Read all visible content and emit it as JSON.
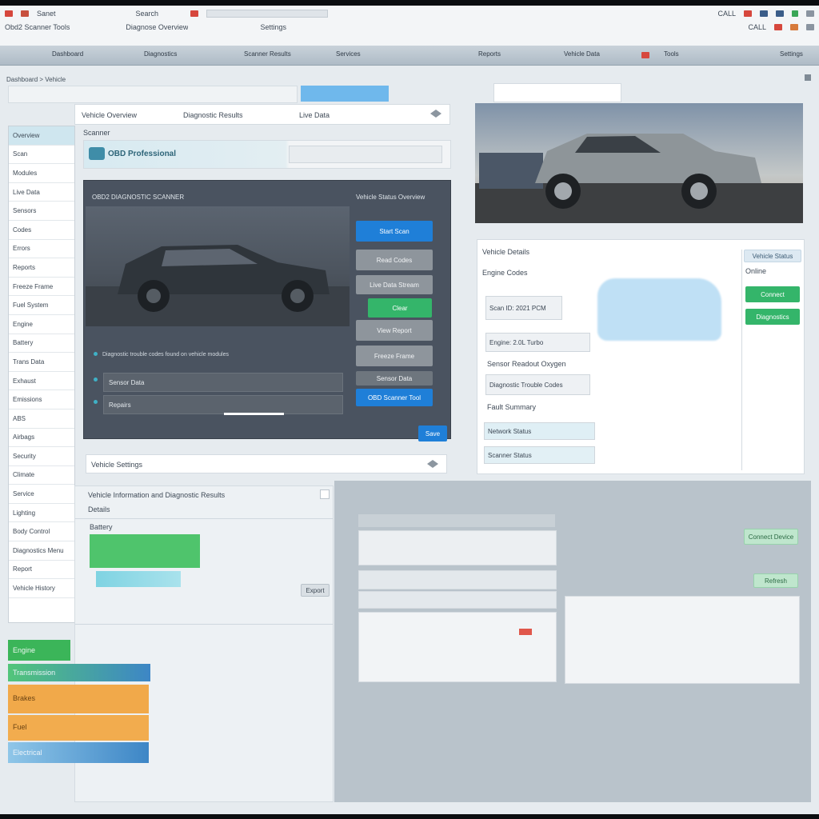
{
  "browser": {
    "row1_left": "Sanet",
    "row1_mid": "Search",
    "row2_left": "Obd2 Scanner Tools",
    "row2_mid": "Diagnose Overview",
    "row2_right": "Settings",
    "right_label1": "CALL",
    "right_label2": "CALL"
  },
  "tabs": [
    "Dashboard",
    "Diagnostics",
    "Scanner Results",
    "Services",
    "Reports",
    "Vehicle Data",
    "Tools",
    "Settings"
  ],
  "breadcrumb": "Dashboard > Vehicle",
  "sidebar": {
    "items": [
      "Overview",
      "Scan",
      "Modules",
      "Live Data",
      "Sensors",
      "Codes",
      "Errors",
      "Reports",
      "Freeze Frame",
      "Fuel System",
      "Engine",
      "Battery",
      "Trans Data",
      "Exhaust",
      "Emissions",
      "ABS",
      "Airbags",
      "Security",
      "Climate",
      "Service",
      "Lighting",
      "Body Control",
      "Diagnostics Menu",
      "Report",
      "Vehicle History"
    ]
  },
  "main_panel": {
    "tabs": [
      "Vehicle Overview",
      "Diagnostic Results",
      "Live Data"
    ],
    "subtitle": "Scanner",
    "logo_text": "OBD Professional",
    "header_left": "OBD2 DIAGNOSTIC SCANNER",
    "header_right": "Vehicle Status Overview",
    "buttons": [
      "Start Scan",
      "Read Codes",
      "Live Data Stream",
      "Clear",
      "View Report",
      "Freeze Frame",
      "Sensor Data",
      "OBD Scanner Tool"
    ],
    "list": [
      "Diagnostic trouble codes found on vehicle modules",
      "Sensor Data",
      "Repairs"
    ],
    "footer_btn": "Save",
    "bottom_bar": "Vehicle Settings"
  },
  "right_panel": {
    "heading": "Vehicle Details",
    "label": "Engine Codes",
    "fields": [
      "Scan ID: 2021 PCM",
      "Engine: 2.0L Turbo",
      "Sensor Readout Oxygen",
      "Diagnostic Trouble Codes",
      "Fault Summary",
      "Network Status",
      "Scanner Status"
    ],
    "side_buttons": [
      "Connect",
      "Diagnostics"
    ],
    "side_label": "Vehicle Status",
    "side_sub": "Online"
  },
  "lower_left": {
    "title": "Vehicle Information and Diagnostic Results",
    "sub": "Details",
    "tag": "Battery",
    "btn": "Export",
    "bars": [
      "Engine",
      "Transmission",
      "Brakes",
      "Fuel",
      "Electrical"
    ]
  },
  "lower_right": {
    "btn1": "Connect Device",
    "btn2": "Refresh"
  },
  "colors": {
    "accent_blue": "#1f7fd8",
    "accent_green": "#34b56a",
    "accent_orange": "#f1a94a"
  }
}
